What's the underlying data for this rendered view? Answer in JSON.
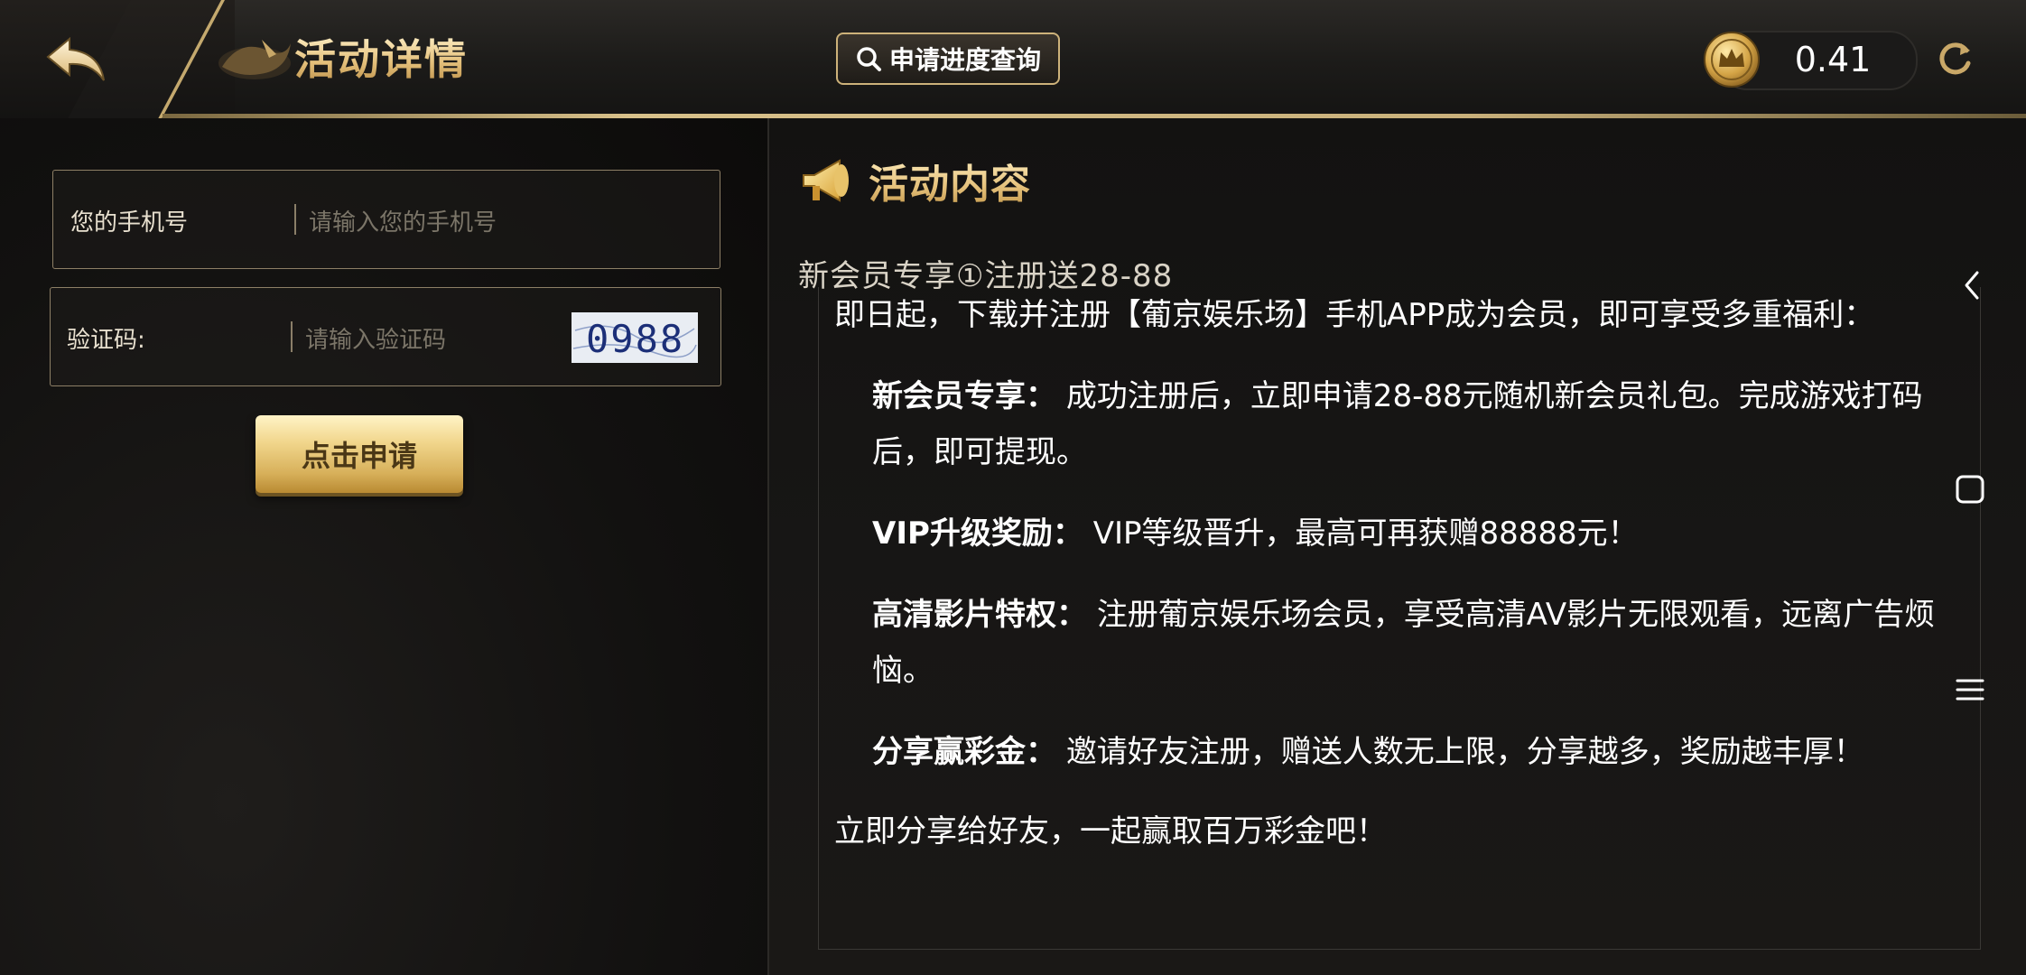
{
  "header": {
    "back_icon": "back-arrow-icon",
    "title": "活动详情",
    "query_button_label": "申请进度查询",
    "query_icon": "search-icon",
    "balance": "0.41",
    "coin_icon": "crown-coin-icon",
    "refresh_icon": "refresh-icon"
  },
  "form": {
    "phone_label": "您的手机号",
    "phone_placeholder": "请输入您的手机号",
    "code_label": "验证码:",
    "code_placeholder": "请输入验证码",
    "captcha_text": "0988",
    "apply_button_label": "点击申请"
  },
  "content": {
    "section_title": "活动内容",
    "promo_title": "新会员专享①注册送28-88",
    "intro": "即日起，下载并注册【葡京娱乐场】手机APP成为会员，即可享受多重福利：",
    "items": [
      {
        "label": "新会员专享：",
        "text": "成功注册后，立即申请28-88元随机新会员礼包。完成游戏打码后，即可提现。"
      },
      {
        "label": "VIP升级奖励：",
        "text": "VIP等级晋升，最高可再获赠88888元！"
      },
      {
        "label": "高清影片特权：",
        "text": "注册葡京娱乐场会员，享受高清AV影片无限观看，远离广告烦恼。"
      },
      {
        "label": "分享赢彩金：",
        "text": "邀请好友注册，赠送人数无上限，分享越多，奖励越丰厚！"
      }
    ],
    "closing": "立即分享给好友，一起赢取百万彩金吧！"
  },
  "colors": {
    "gold_accent": "#d8c08a",
    "button_gold": "#e8c674",
    "background": "#0d0c0b"
  }
}
